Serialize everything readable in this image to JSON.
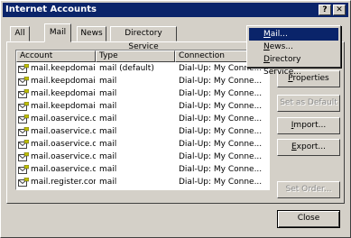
{
  "window": {
    "title": "Internet Accounts"
  },
  "titlebar_buttons": {
    "help": "?",
    "close": "✕"
  },
  "tabs": [
    {
      "label": "All"
    },
    {
      "label": "Mail"
    },
    {
      "label": "News"
    },
    {
      "label": "Directory Service"
    }
  ],
  "list": {
    "columns": [
      "Account",
      "Type",
      "Connection"
    ],
    "rows": [
      {
        "account": "mail.keepdomain....",
        "type": "mail (default)",
        "connection": "Dial-Up: My Conne..."
      },
      {
        "account": "mail.keepdomain....",
        "type": "mail",
        "connection": "Dial-Up: My Conne..."
      },
      {
        "account": "mail.keepdomain....",
        "type": "mail",
        "connection": "Dial-Up: My Conne..."
      },
      {
        "account": "mail.keepdomain....",
        "type": "mail",
        "connection": "Dial-Up: My Conne..."
      },
      {
        "account": "mail.oaservice.com",
        "type": "mail",
        "connection": "Dial-Up: My Conne..."
      },
      {
        "account": "mail.oaservice.co...",
        "type": "mail",
        "connection": "Dial-Up: My Conne..."
      },
      {
        "account": "mail.oaservice.co...",
        "type": "mail",
        "connection": "Dial-Up: My Conne..."
      },
      {
        "account": "mail.oaservice.co...",
        "type": "mail",
        "connection": "Dial-Up: My Conne..."
      },
      {
        "account": "mail.oaservice.co...",
        "type": "mail",
        "connection": "Dial-Up: My Conne..."
      },
      {
        "account": "mail.register.com",
        "type": "mail",
        "connection": "Dial-Up: My Conne..."
      }
    ]
  },
  "add_menu": {
    "items": [
      {
        "label": "Mail...",
        "mnemonic": "M",
        "rest": "ail..."
      },
      {
        "label": "News...",
        "mnemonic": "N",
        "rest": "ews..."
      },
      {
        "label": "Directory Service...",
        "mnemonic": "D",
        "rest": "irectory Service..."
      }
    ]
  },
  "buttons": {
    "properties": {
      "mnemonic": "P",
      "rest": "roperties"
    },
    "set_as_default": {
      "label": "Set as Default"
    },
    "import": {
      "mnemonic": "I",
      "rest": "mport..."
    },
    "export": {
      "mnemonic": "E",
      "rest": "xport..."
    },
    "set_order": {
      "label": "Set Order..."
    },
    "close": {
      "label": "Close"
    }
  },
  "colors": {
    "face": "#d4d0c8",
    "title": "#0a246a",
    "selection": "#0a246a"
  },
  "icons": {
    "mail_account": "mail-account-icon"
  }
}
